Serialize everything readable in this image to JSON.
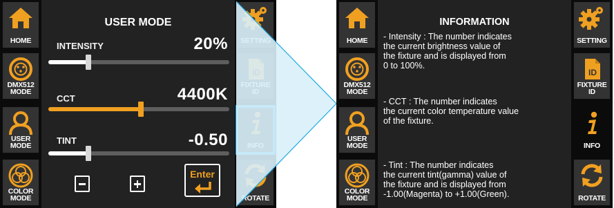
{
  "nav": {
    "home": "HOME",
    "dmx": "DMX512\nMODE",
    "user": "USER\nMODE",
    "color": "COLOR\nMODE",
    "setting": "SETTING",
    "fixture": "FIXTURE\nID",
    "info": "INFO",
    "rotate": "ROTATE",
    "id_glyph": "ID"
  },
  "user_mode": {
    "title": "USER MODE",
    "intensity": {
      "label": "INTENSITY",
      "value": "20%",
      "slider_fraction": 0.22
    },
    "cct": {
      "label": "CCT",
      "value": "4400K",
      "slider_fraction": 0.51
    },
    "tint": {
      "label": "TINT",
      "value": "-0.50",
      "slider_fraction": 0.22
    },
    "enter_label": "Enter"
  },
  "info": {
    "title": "INFORMATION",
    "intensity_text": "- Intensity : The number indicates\n  the current brightness value of\n  the fixture and is displayed from\n  0 to 100%.",
    "cct_text": "- CCT : The number indicates\n  the current color temperature value\n  of the fixture.",
    "tint_text": "- Tint : The number indicates\n  the current tint(gamma) value of\n  the fixture and is displayed from\n  -1.00(Magenta) to +1.00(Green)."
  },
  "colors": {
    "accent_orange": "#f0a021",
    "selected_blue": "#1aa9df",
    "white": "#ffffff",
    "screen_bg": "#222222",
    "arrow_fill": "#d9f0fb"
  },
  "icons": {
    "home": "home-icon",
    "dmx": "dmx-connector-icon",
    "user": "user-icon",
    "color": "color-circles-icon",
    "setting": "gear-icon",
    "fixture": "id-tag-icon",
    "info": "info-icon",
    "rotate": "rotate-icon",
    "minus": "minus-icon",
    "plus": "plus-icon",
    "enter": "enter-icon"
  }
}
